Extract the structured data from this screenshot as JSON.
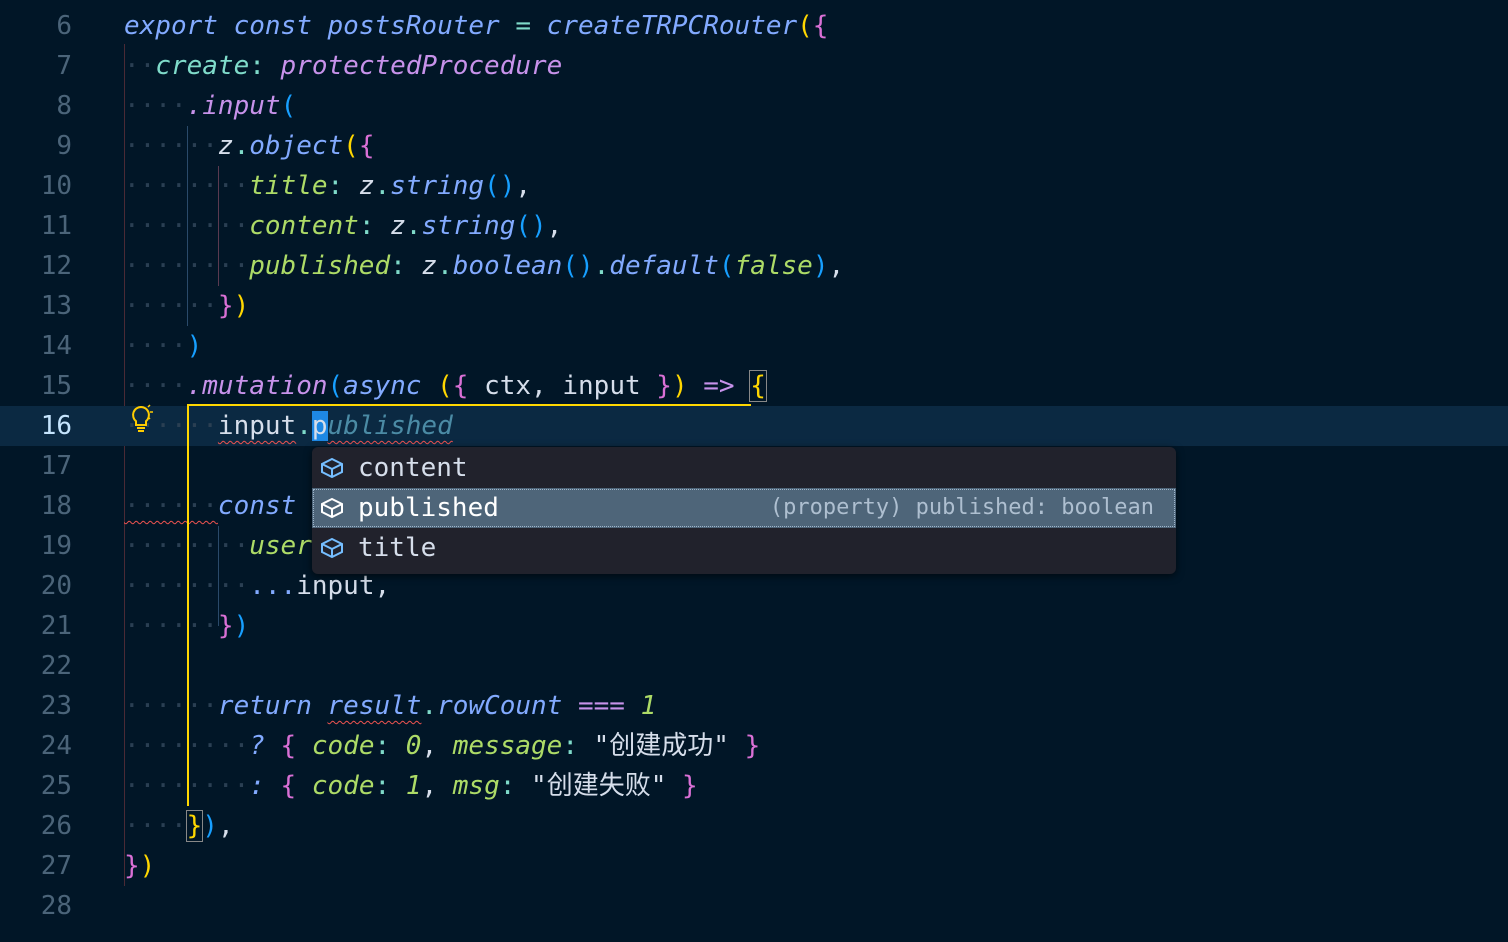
{
  "editor": {
    "lines": [
      {
        "n": "6"
      },
      {
        "n": "7"
      },
      {
        "n": "8"
      },
      {
        "n": "9"
      },
      {
        "n": "10"
      },
      {
        "n": "11"
      },
      {
        "n": "12"
      },
      {
        "n": "13"
      },
      {
        "n": "14"
      },
      {
        "n": "15"
      },
      {
        "n": "16"
      },
      {
        "n": "17"
      },
      {
        "n": "18"
      },
      {
        "n": "19"
      },
      {
        "n": "20"
      },
      {
        "n": "21"
      },
      {
        "n": "22"
      },
      {
        "n": "23"
      },
      {
        "n": "24"
      },
      {
        "n": "25"
      },
      {
        "n": "26"
      },
      {
        "n": "27"
      },
      {
        "n": "28"
      }
    ],
    "tokens": {
      "l6_export": "export",
      "l6_const": "const",
      "l6_name": "postsRouter",
      "l6_eq": " = ",
      "l6_fn": "createTRPCRouter",
      "l7_key": "create",
      "l7_colon": ":",
      "l7_val": "protectedProcedure",
      "l8_dot": ".",
      "l8_fn": "input",
      "l9_z": "z",
      "l9_dot": ".",
      "l9_fn": "object",
      "l10_key": "title",
      "l10_z": "z",
      "l10_fn": "string",
      "l11_key": "content",
      "l11_z": "z",
      "l11_fn": "string",
      "l12_key": "published",
      "l12_z": "z",
      "l12_fn": "boolean",
      "l12_fn2": "default",
      "l12_val": "false",
      "l15_fn": "mutation",
      "l15_async": "async",
      "l15_ctx": "ctx",
      "l15_input": "input",
      "l15_arrow": "=>",
      "l16_input": "input",
      "l16_p": "p",
      "l16_ghost": "ublished",
      "l18_const": "const",
      "l19_user": "user",
      "l20_spread": "...",
      "l20_input": "input",
      "l23_return": "return",
      "l23_result": "result",
      "l23_prop": "rowCount",
      "l23_op": "===",
      "l23_num": "1",
      "l24_q": "?",
      "l24_code": "code",
      "l24_num": "0",
      "l24_msg": "message",
      "l24_str": "\"创建成功\"",
      "l25_c": ":",
      "l25_code": "code",
      "l25_num": "1",
      "l25_msg": "msg",
      "l25_str": "\"创建失败\""
    }
  },
  "suggest": {
    "items": [
      {
        "label": "content",
        "icon": "property-icon"
      },
      {
        "label": "published",
        "icon": "property-icon",
        "detail": "(property) published: boolean"
      },
      {
        "label": "title",
        "icon": "property-icon"
      }
    ],
    "selected_index": 1
  },
  "colors": {
    "background": "#011627",
    "current_line": "#0b2942",
    "keyword": "#82aaff",
    "property": "#addb67",
    "bracket_gold": "#ffd700",
    "bracket_magenta": "#da70d6",
    "bracket_blue": "#179fff",
    "error": "#ef5350"
  }
}
